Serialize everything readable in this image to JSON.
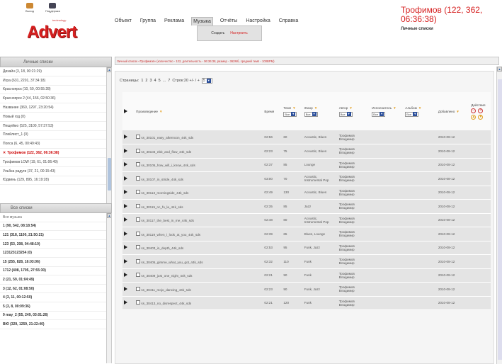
{
  "header": {
    "logo_text": "Advert",
    "logo_subtitle": "technology",
    "help_label": "Выход",
    "support_label": "Поддержка",
    "menu": [
      "Объект",
      "Группа",
      "Реклама",
      "Музыка",
      "Отчёты",
      "Настройка",
      "Справка"
    ],
    "active_menu": "Музыка",
    "submenu": [
      "Создать",
      "Настроить"
    ],
    "user_name": "Трофимов (122, 362, 06:36:38)",
    "user_role": "Личные списки"
  },
  "sidebar": {
    "personal_header": "Личные списки",
    "personal_lists": [
      {
        "label": "Дизайн (3, 18, 00:21:29)",
        "active": false
      },
      {
        "label": "Игра (631, 2201, 37:34:18)",
        "active": false
      },
      {
        "label": "Красноярск (10, 50, 00:55:28)",
        "active": false
      },
      {
        "label": "Красноярск 2 (44, 156, 02:50:36)",
        "active": false
      },
      {
        "label": "Название (360, 1297, 23:20:54)",
        "active": false
      },
      {
        "label": "Новый год (0)",
        "active": false
      },
      {
        "label": "Пещеймо (525, 3100, 57:37:53)",
        "active": false
      },
      {
        "label": "Плейлист_1 (0)",
        "active": false
      },
      {
        "label": "Попса (6, 45, 00:49:43)",
        "active": false
      },
      {
        "label": "Трофимов (122, 362, 06:36:38)",
        "active": true
      },
      {
        "label": "Трофимов LOW (19, 61, 01:06:49)",
        "active": false
      },
      {
        "label": "Ульбка радуги (37, 21, 00:15:43)",
        "active": false
      },
      {
        "label": "Юдвинь (129, 895, 16:19:28)",
        "active": false
      }
    ],
    "all_header": "Все списки",
    "all_lists": [
      {
        "label": "Вся музыка",
        "plain": true
      },
      {
        "label": "1 (90, 542, 08:18:54)",
        "plain": false
      },
      {
        "label": "121 (318, 1100, 21:50:21)",
        "plain": false
      },
      {
        "label": "123 (53, 208, 04:48:10)",
        "plain": false
      },
      {
        "label": "123123123254 (0)",
        "plain": false
      },
      {
        "label": "15 (255, 828, 16:03:06)",
        "plain": false
      },
      {
        "label": "1712 (408, 1705, 27:55:30)",
        "plain": false
      },
      {
        "label": "2 (21, 59, 01:04:49)",
        "plain": false
      },
      {
        "label": "3 (12, 62, 01:08:50)",
        "plain": false
      },
      {
        "label": "4 (3, 11, 00:12:50)",
        "plain": false
      },
      {
        "label": "5 (3, 8, 00:09:36)",
        "plain": false
      },
      {
        "label": "9 may_2 (55, 249, 03:01:26)",
        "plain": false
      },
      {
        "label": "ВЮ (329, 1259, 21:22:40)",
        "plain": false
      }
    ]
  },
  "info_bar": "Личный список «Трофимов» (количество - 122, длительность - 06:36:38, размер - 362Мб, средний темп - 100BPM)",
  "pagination": {
    "label": "Страницы:",
    "pages": [
      "1",
      "2",
      "3",
      "4",
      "5",
      "...",
      "7"
    ],
    "rows_label": "Строк:20 +/- / +",
    "rows_value": "5"
  },
  "table": {
    "columns": {
      "track": "Произведение",
      "time": "Время",
      "tempo": "Темп",
      "genre": "Жанр",
      "author": "Автор",
      "artist": "Исполнитель",
      "album": "Альбом",
      "added": "Добавлено",
      "actions": "Действия"
    },
    "filter_all": "Все",
    "rows": [
      {
        "name": "ss_30101_easy_afternoon_44k_sds",
        "time": "02:56",
        "tempo": "60",
        "genre": "Acoustic, Blues",
        "author": "Трофимов Владимир",
        "added": "2010-08-12"
      },
      {
        "name": "ss_30103_ebb_and_flow_44k_sds",
        "time": "02:23",
        "tempo": "75",
        "genre": "Acoustic, Blues",
        "author": "Трофимов Владимир",
        "added": "2010-08-12"
      },
      {
        "name": "ss_30105_how_will_i_know_44k_sds",
        "time": "02:37",
        "tempo": "85",
        "genre": "Lounge",
        "author": "Трофимов Владимир",
        "added": "2010-08-12"
      },
      {
        "name": "ss_30107_in_stride_44k_sds",
        "time": "03:00",
        "tempo": "70",
        "genre": "Acoustic, Instrumental Pop",
        "author": "Трофимов Владимир",
        "added": "2010-08-12"
      },
      {
        "name": "ss_30113_morningside_44k_sds",
        "time": "02:49",
        "tempo": "130",
        "genre": "Acoustic, Blues",
        "author": "Трофимов Владимир",
        "added": "2010-08-12"
      },
      {
        "name": "ss_30115_nc_fo_la_44k_sds",
        "time": "02:35",
        "tempo": "85",
        "genre": "Jazz",
        "author": "Трофимов Владимир",
        "added": "2010-08-12"
      },
      {
        "name": "ss_30117_the_best_in_me_44k_sds",
        "time": "02:48",
        "tempo": "80",
        "genre": "Acoustic, Instrumental Pop",
        "author": "Трофимов Владимир",
        "added": "2010-08-12"
      },
      {
        "name": "ss_30119_when_i_look_at_you_44k_sds",
        "time": "02:39",
        "tempo": "65",
        "genre": "Blues, Lounge",
        "author": "Трофимов Владимир",
        "added": "2010-08-12"
      },
      {
        "name": "ss_30403_in_depth_44k_sds",
        "time": "02:53",
        "tempo": "95",
        "genre": "Funk, Jazz",
        "author": "Трофимов Владимир",
        "added": "2010-08-12"
      },
      {
        "name": "ss_30405_gimme_what_you_got_44k_sds",
        "time": "02:32",
        "tempo": "110",
        "genre": "Funk",
        "author": "Трофимов Владимир",
        "added": "2010-08-12"
      },
      {
        "name": "ss_30409_just_one_night_44k_sds",
        "time": "02:21",
        "tempo": "90",
        "genre": "Funk",
        "author": "Трофимов Владимир",
        "added": "2010-08-12"
      },
      {
        "name": "ss_30411_mojo_dancing_44k_sds",
        "time": "02:23",
        "tempo": "90",
        "genre": "Funk, Jazz",
        "author": "Трофимов Владимир",
        "added": "2010-08-12"
      },
      {
        "name": "ss_30413_no_disrespect_44k_sds",
        "time": "02:21",
        "tempo": "120",
        "genre": "Funk",
        "author": "Трофимов Владимир",
        "added": "2010-08-12"
      }
    ]
  },
  "colors": {
    "brand_red": "#d62020",
    "accent_orange": "#e5a020",
    "select_blue": "#2a4e9a"
  }
}
